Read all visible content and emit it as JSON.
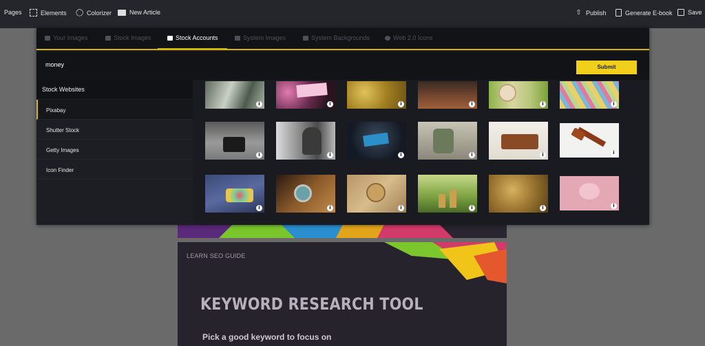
{
  "topbar": {
    "pages_label": "Pages",
    "elements_label": "Elements",
    "colorizer_label": "Colorizer",
    "new_article_label": "New Article",
    "publish_label": "Publish",
    "generate_ebook_label": "Generate E-book",
    "save_label": "Save"
  },
  "modal": {
    "tabs": [
      {
        "label": "Your Images",
        "icon": "list-icon"
      },
      {
        "label": "Stock Images",
        "icon": "image-icon"
      },
      {
        "label": "Stock Accounts",
        "icon": "cart-icon"
      },
      {
        "label": "System Images",
        "icon": "image-icon"
      },
      {
        "label": "System Backgrounds",
        "icon": "image-icon"
      },
      {
        "label": "Web 2.0 Icons",
        "icon": "globe-icon"
      }
    ],
    "active_tab": "Stock Accounts",
    "search": {
      "value": "money",
      "placeholder": ""
    },
    "submit_label": "Submit",
    "sidebar": {
      "heading": "Stock Websites",
      "items": [
        {
          "label": "Pixabay",
          "selected": true
        },
        {
          "label": "Shutter Stock",
          "selected": false
        },
        {
          "label": "Getty Images",
          "selected": false
        },
        {
          "label": "Icon Finder",
          "selected": false
        }
      ]
    },
    "thumbnails": [
      {
        "name": "dollar-bills"
      },
      {
        "name": "bills-bokeh"
      },
      {
        "name": "gold-coins"
      },
      {
        "name": "cafe-coins"
      },
      {
        "name": "piggy-clock"
      },
      {
        "name": "colorful-banknotes"
      },
      {
        "name": "street-case"
      },
      {
        "name": "homeless-man"
      },
      {
        "name": "pocket-cards"
      },
      {
        "name": "man-sitting"
      },
      {
        "name": "leather-wallet"
      },
      {
        "name": "auction-gavel"
      },
      {
        "name": "jeans-coins"
      },
      {
        "name": "compass-watch"
      },
      {
        "name": "bitcoin-coin"
      },
      {
        "name": "coin-stacks-plants"
      },
      {
        "name": "bitcoin-pile"
      },
      {
        "name": "pink-piggy-bank"
      }
    ],
    "info_badge": "i",
    "accent_color": "#d4b80d",
    "button_color": "#f1cf1a"
  },
  "background_page": {
    "learn_label": "LEARN SEO GUIDE",
    "headline": "KEYWORD RESEARCH TOOL",
    "subtext": "Pick a good keyword to focus on"
  }
}
